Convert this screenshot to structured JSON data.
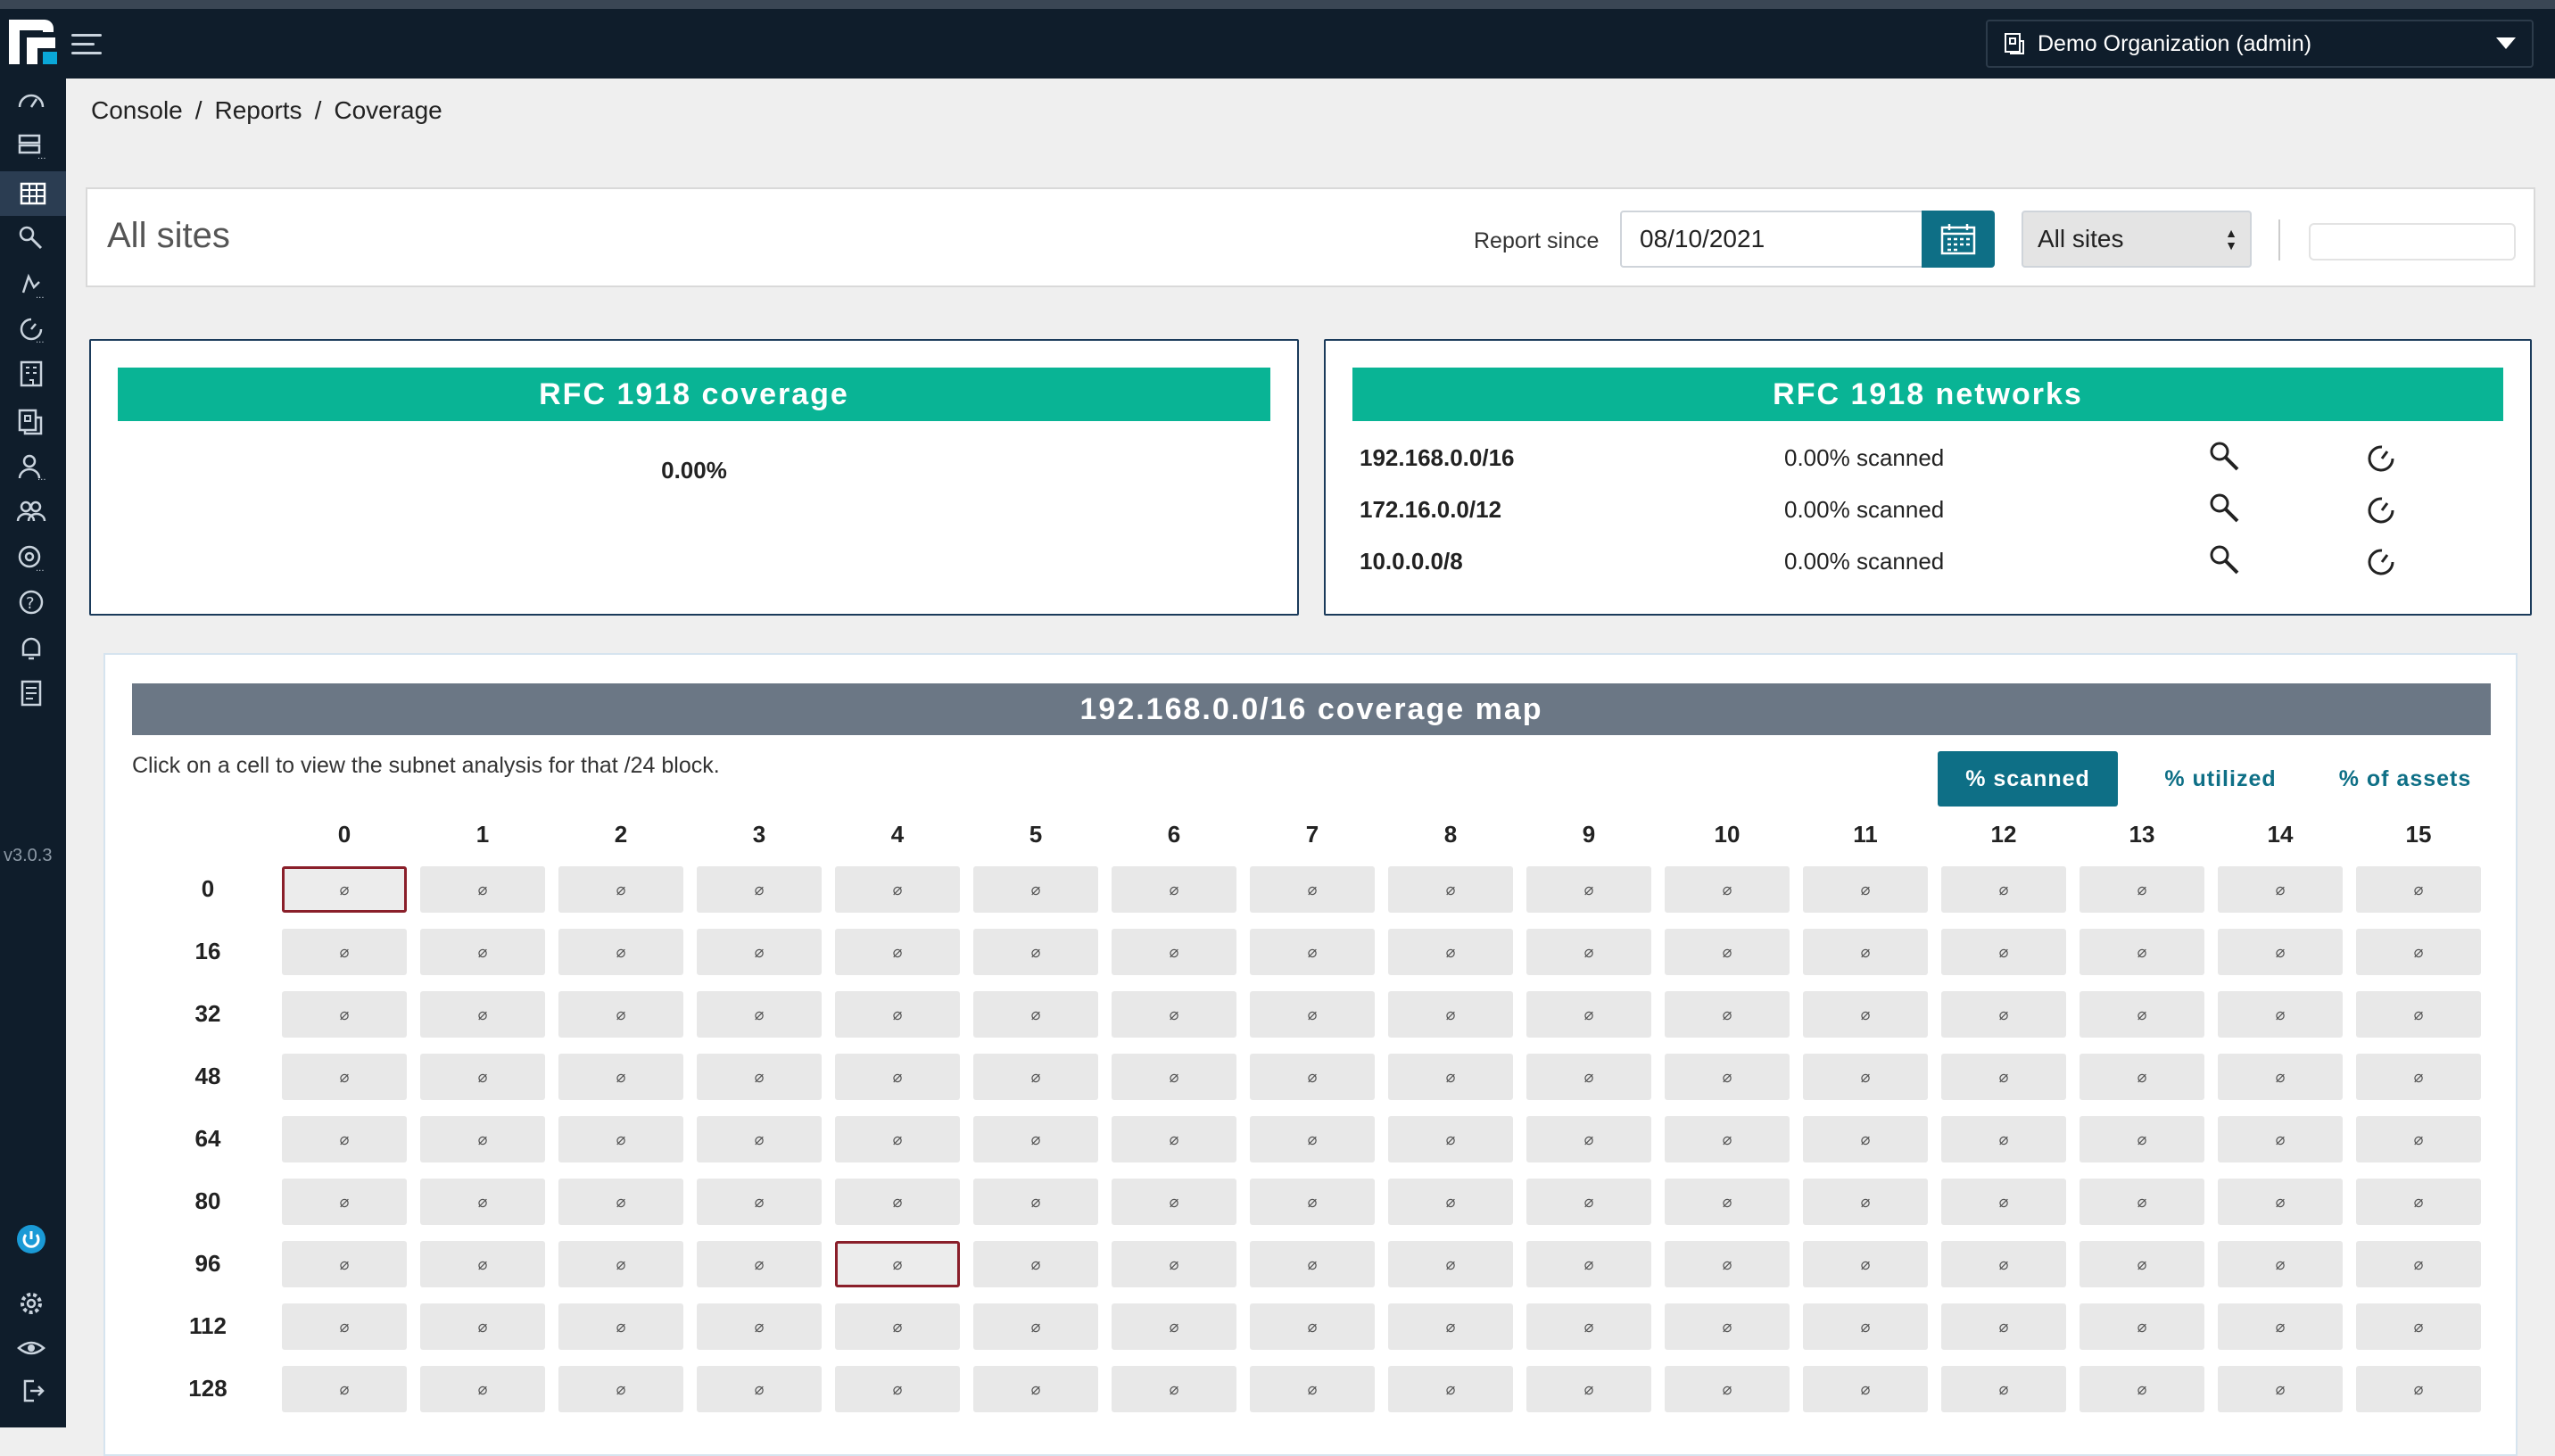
{
  "org": {
    "label": "Demo Organization (admin)"
  },
  "sidebar": {
    "version": "v3.0.3"
  },
  "breadcrumb": [
    "Console",
    "Reports",
    "Coverage"
  ],
  "header": {
    "title": "All sites",
    "report_since_label": "Report since",
    "date_value": "08/10/2021",
    "site_select": "All sites"
  },
  "coverage_card": {
    "title": "RFC 1918 coverage",
    "value": "0.00%"
  },
  "networks_card": {
    "title": "RFC 1918 networks",
    "rows": [
      {
        "cidr": "192.168.0.0/16",
        "pct": "0.00% scanned"
      },
      {
        "cidr": "172.16.0.0/12",
        "pct": "0.00% scanned"
      },
      {
        "cidr": "10.0.0.0/8",
        "pct": "0.00% scanned"
      }
    ]
  },
  "map": {
    "title": "192.168.0.0/16 coverage map",
    "instructions": "Click on a cell to view the subnet analysis for that /24 block.",
    "toggles": [
      "% scanned",
      "% utilized",
      "% of assets"
    ],
    "active_toggle": 0,
    "columns": [
      "0",
      "1",
      "2",
      "3",
      "4",
      "5",
      "6",
      "7",
      "8",
      "9",
      "10",
      "11",
      "12",
      "13",
      "14",
      "15"
    ],
    "rows": [
      "0",
      "16",
      "32",
      "48",
      "64",
      "80",
      "96",
      "112",
      "128"
    ],
    "cell_symbol": "⌀",
    "selected_cells": [
      {
        "row": 0,
        "col": 0
      },
      {
        "row": 6,
        "col": 4
      }
    ]
  },
  "colors": {
    "accent": "#09b495",
    "primary": "#0e6f86",
    "nav": "#0f1d2b",
    "map_header": "#6b7785",
    "selected": "#8a1f2a"
  }
}
